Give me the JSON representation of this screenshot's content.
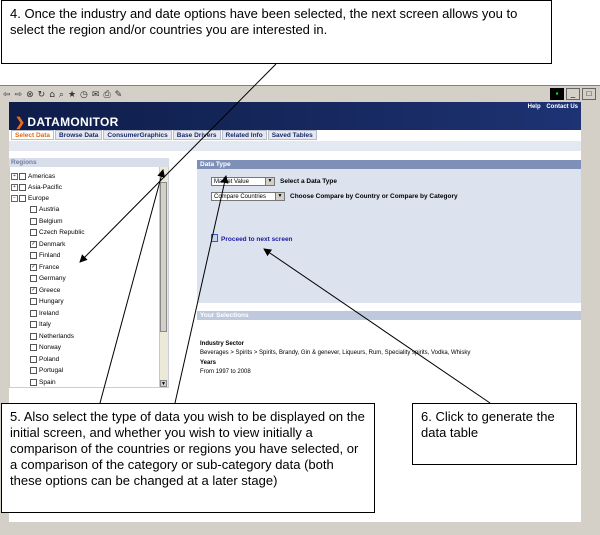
{
  "callouts": {
    "c4": "4. Once the industry and date options have been selected, the next screen allows you to select the region and/or countries you are interested in.",
    "c5": "5. Also select the type of data you wish to be displayed on the initial screen, and whether you wish to view initially a comparison of the countries or regions you have selected, or a comparison of the category or sub-category data (both these options can be changed at a later stage)",
    "c6": "6. Click to generate the data table"
  },
  "app": {
    "logo": "DATAMONITOR",
    "toplinks": [
      "Help",
      "Contact Us"
    ],
    "tabs": [
      "Select Data",
      "Browse Data",
      "ConsumerGraphics",
      "Base Drivers",
      "Related Info",
      "Saved Tables"
    ]
  },
  "regions": {
    "header": "Regions",
    "groups": [
      "Americas",
      "Asia-Pacific",
      "Europe"
    ],
    "countries": [
      {
        "name": "Austria",
        "checked": false
      },
      {
        "name": "Belgium",
        "checked": false
      },
      {
        "name": "Czech Republic",
        "checked": false
      },
      {
        "name": "Denmark",
        "checked": true
      },
      {
        "name": "Finland",
        "checked": false
      },
      {
        "name": "France",
        "checked": true
      },
      {
        "name": "Germany",
        "checked": false
      },
      {
        "name": "Greece",
        "checked": true
      },
      {
        "name": "Hungary",
        "checked": false
      },
      {
        "name": "Ireland",
        "checked": false
      },
      {
        "name": "Italy",
        "checked": false
      },
      {
        "name": "Netherlands",
        "checked": false
      },
      {
        "name": "Norway",
        "checked": false
      },
      {
        "name": "Poland",
        "checked": false
      },
      {
        "name": "Portugal",
        "checked": false
      },
      {
        "name": "Spain",
        "checked": false
      }
    ]
  },
  "datatype": {
    "header": "Data Type",
    "select1_value": "Market Value",
    "select1_label": "Select a Data Type",
    "select2_value": "Compare Countries",
    "select2_label": "Choose Compare by Country or Compare by Category",
    "proceed": "Proceed to next screen"
  },
  "selections": {
    "header": "Your Selections",
    "industry_label": "Industry Sector",
    "industry_value": "Beverages > Spirits > Spirits, Brandy,  Gin & genever,  Liqueurs,  Rum,  Speciality spirits,  Vodka,  Whisky",
    "years_label": "Years",
    "years_value": "From 1997 to 2008"
  },
  "colors": {
    "header_bg": "#16285e",
    "active_tab": "#e06a10",
    "section_header": "#7f90b8"
  }
}
